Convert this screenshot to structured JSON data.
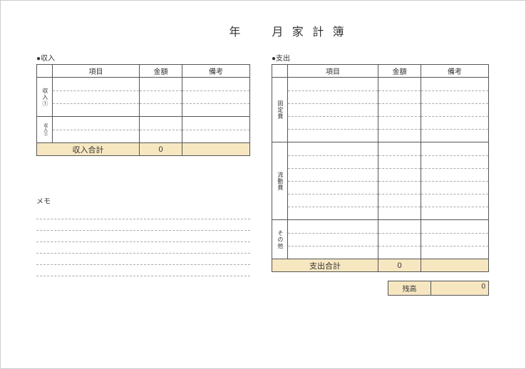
{
  "title": "年　　月 家 計 簿",
  "income": {
    "section_label": "●収入",
    "headers": {
      "item": "項目",
      "amount": "金額",
      "note": "備考"
    },
    "group1_label": "収入①",
    "group2_label": "収入②",
    "total_label": "収入合計",
    "total_amount": "0"
  },
  "expense": {
    "section_label": "●支出",
    "headers": {
      "item": "項目",
      "amount": "金額",
      "note": "備考"
    },
    "group1_label": "固定費",
    "group2_label": "流動費",
    "group3_label": "その他",
    "total_label": "支出合計",
    "total_amount": "0"
  },
  "memo": {
    "label": "メモ"
  },
  "balance": {
    "label": "残高",
    "amount": "0"
  }
}
